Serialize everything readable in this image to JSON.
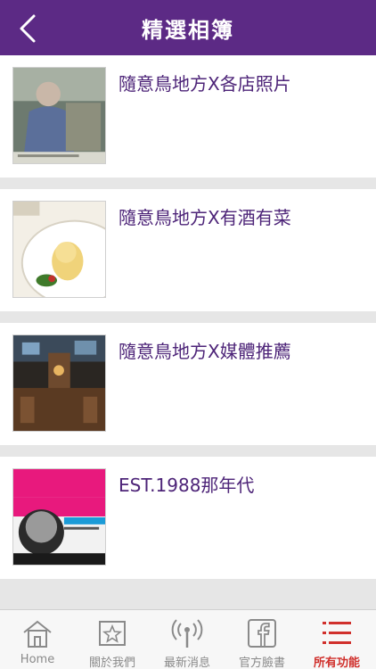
{
  "header": {
    "title": "精選相簿",
    "back_icon": "chevron-left-icon",
    "background": "#5c2a85"
  },
  "albums": [
    {
      "title": "隨意鳥地方X各店照片",
      "thumb": "store-photo"
    },
    {
      "title": "隨意鳥地方X有酒有菜",
      "thumb": "food-photo"
    },
    {
      "title": "隨意鳥地方X媒體推薦",
      "thumb": "bar-interior-photo"
    },
    {
      "title": "EST.1988那年代",
      "thumb": "poster-photo"
    }
  ],
  "tabbar": {
    "tabs": [
      {
        "label": "Home",
        "icon": "home-icon",
        "active": false
      },
      {
        "label": "關於我們",
        "icon": "star-icon",
        "active": false
      },
      {
        "label": "最新消息",
        "icon": "broadcast-icon",
        "active": false
      },
      {
        "label": "官方臉書",
        "icon": "facebook-icon",
        "active": false
      },
      {
        "label": "所有功能",
        "icon": "menu-list-icon",
        "active": true
      }
    ],
    "active_color": "#d0302c",
    "inactive_color": "#8a8a8a"
  }
}
